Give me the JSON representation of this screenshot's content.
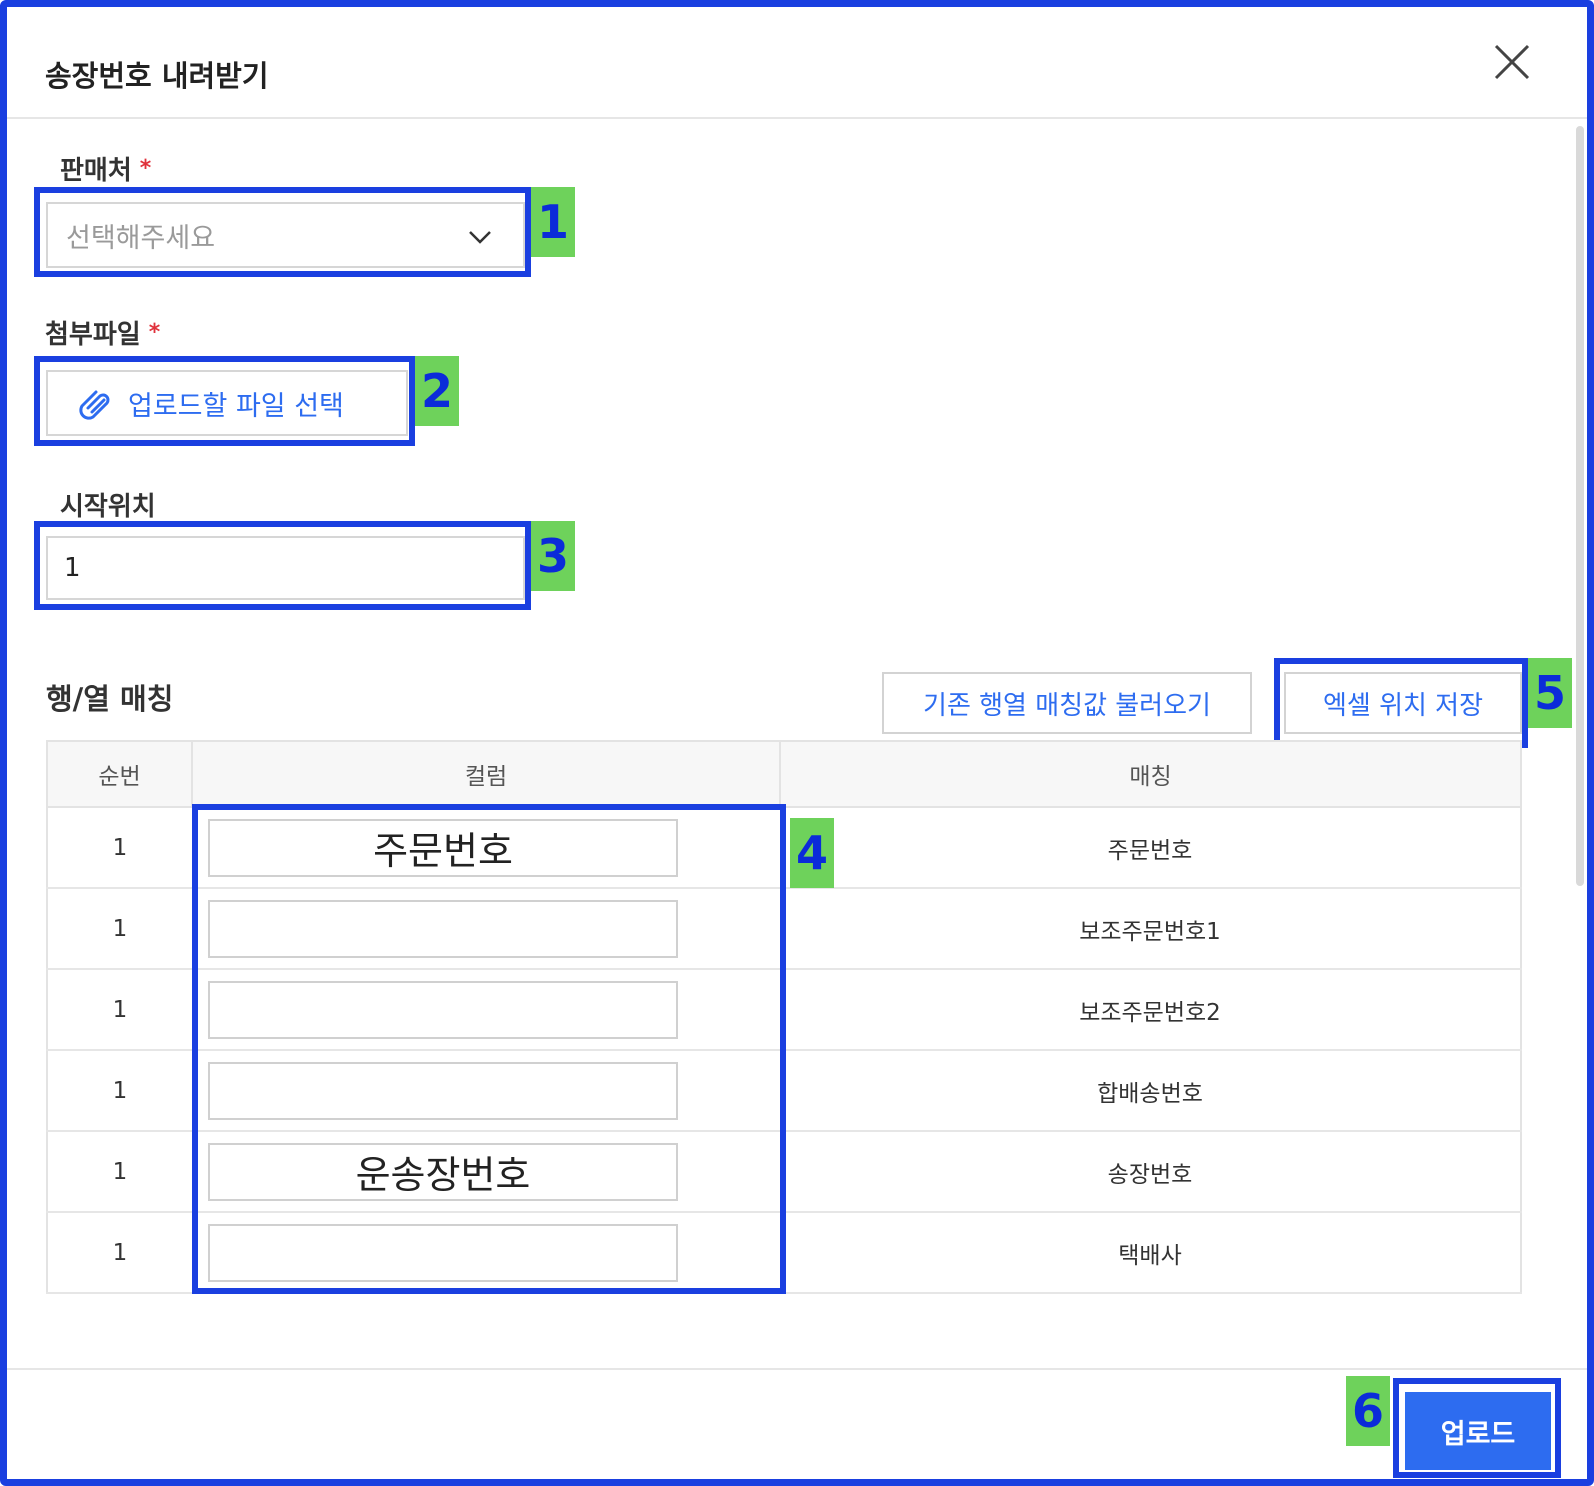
{
  "dialog": {
    "title": "송장번호 내려받기"
  },
  "seller": {
    "label": "판매처",
    "required_mark": "*",
    "placeholder": "선택해주세요"
  },
  "attachment": {
    "label": "첨부파일",
    "required_mark": "*",
    "button_label": "업로드할 파일 선택"
  },
  "start_position": {
    "label": "시작위치",
    "value": "1"
  },
  "matching": {
    "title": "행/열 매칭",
    "load_button_label": "기존 행열 매칭값 불러오기",
    "save_button_label": "엑셀 위치 저장",
    "headers": [
      "순번",
      "컬럼",
      "매칭"
    ],
    "rows": [
      {
        "seq": "1",
        "column": "주문번호",
        "match": "주문번호"
      },
      {
        "seq": "1",
        "column": "",
        "match": "보조주문번호1"
      },
      {
        "seq": "1",
        "column": "",
        "match": "보조주문번호2"
      },
      {
        "seq": "1",
        "column": "",
        "match": "합배송번호"
      },
      {
        "seq": "1",
        "column": "운송장번호",
        "match": "송장번호"
      },
      {
        "seq": "1",
        "column": "",
        "match": "택배사"
      }
    ]
  },
  "footer": {
    "upload_button_label": "업로드"
  },
  "annotations": {
    "labels": [
      "1",
      "2",
      "3",
      "4",
      "5",
      "6"
    ],
    "highlight_color": "#1a3fe0",
    "label_bg_color": "#6ed25b"
  },
  "colors": {
    "primary": "#2d6cf0",
    "required": "#e0323c"
  }
}
